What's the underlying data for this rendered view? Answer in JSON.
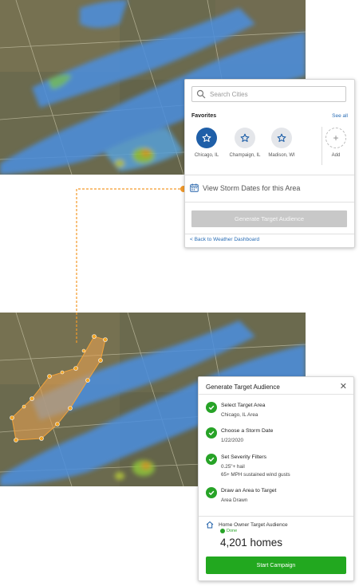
{
  "search_panel": {
    "search_placeholder": "Search Cities",
    "favorites_title": "Favorites",
    "see_all": "See all",
    "favorites": [
      {
        "label": "Chicago, IL",
        "active": true
      },
      {
        "label": "Champaign, IL",
        "active": false
      },
      {
        "label": "Madison, WI",
        "active": false
      }
    ],
    "add_label": "Add",
    "storm_dates_label": "View Storm Dates for this Area",
    "generate_button": "Generate Target Audience",
    "back_link": "< Back to Weather Dashboard"
  },
  "target_panel": {
    "title": "Generate Target Audience",
    "steps": [
      {
        "title": "Select Target Area",
        "values": [
          "Chicago, IL Area"
        ]
      },
      {
        "title": "Choose a Storm Date",
        "values": [
          "1/22/2020"
        ]
      },
      {
        "title": "Set Severity Filters",
        "values": [
          "0.25\"+ hail",
          "65+ MPH sustained wind gusts"
        ]
      },
      {
        "title": "Draw an Area to Target",
        "values": [
          "Area Drawn"
        ]
      }
    ],
    "audience_title": "Home Owner Target Audience",
    "audience_status": "Done",
    "audience_count": "4,201 homes",
    "campaign_button": "Start Campaign"
  },
  "colors": {
    "accent_blue": "#1f5fa8",
    "success_green": "#22a81f",
    "connector_orange": "#f39a2a",
    "disabled_gray": "#c8c8c8"
  }
}
